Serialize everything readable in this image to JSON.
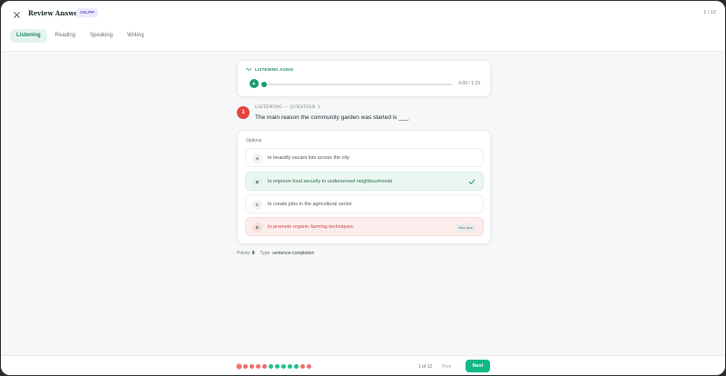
{
  "header": {
    "title": "Review Answers",
    "badge": "CELPIP",
    "progress": "1 / 12"
  },
  "tabs": [
    {
      "label": "Listening",
      "active": true
    },
    {
      "label": "Reading",
      "active": false
    },
    {
      "label": "Speaking",
      "active": false
    },
    {
      "label": "Writing",
      "active": false
    }
  ],
  "audio": {
    "label": "LISTENING AUDIO",
    "time": "0:00 / 1:29",
    "progress": 0
  },
  "question": {
    "number": "1",
    "section": "LISTENING — QUESTION 1",
    "text": "The main reason the community garden was started is ___."
  },
  "options": {
    "label": "Options",
    "items": [
      {
        "letter": "A",
        "text": "to beautify vacant lots across the city",
        "state": "neutral"
      },
      {
        "letter": "B",
        "text": "to improve food security in underserved neighbourhoods",
        "state": "correct"
      },
      {
        "letter": "C",
        "text": "to create jobs in the agricultural sector",
        "state": "neutral"
      },
      {
        "letter": "D",
        "text": "to promote organic farming techniques",
        "state": "wrong",
        "tag": "Your pick"
      }
    ]
  },
  "meta": {
    "points_label": "Points:",
    "points_value": "0",
    "type_label": "Type:",
    "type_value": "sentence-completion"
  },
  "footer": {
    "dots": [
      "red",
      "red",
      "red",
      "red",
      "red",
      "green",
      "green",
      "green",
      "green",
      "green",
      "red",
      "red"
    ],
    "page_of": "1 of 12",
    "prev_label": "Prev",
    "next_label": "Next"
  },
  "colors": {
    "accent": "#12b886",
    "red": "#ef6f6b",
    "green": "#1fc28c"
  }
}
